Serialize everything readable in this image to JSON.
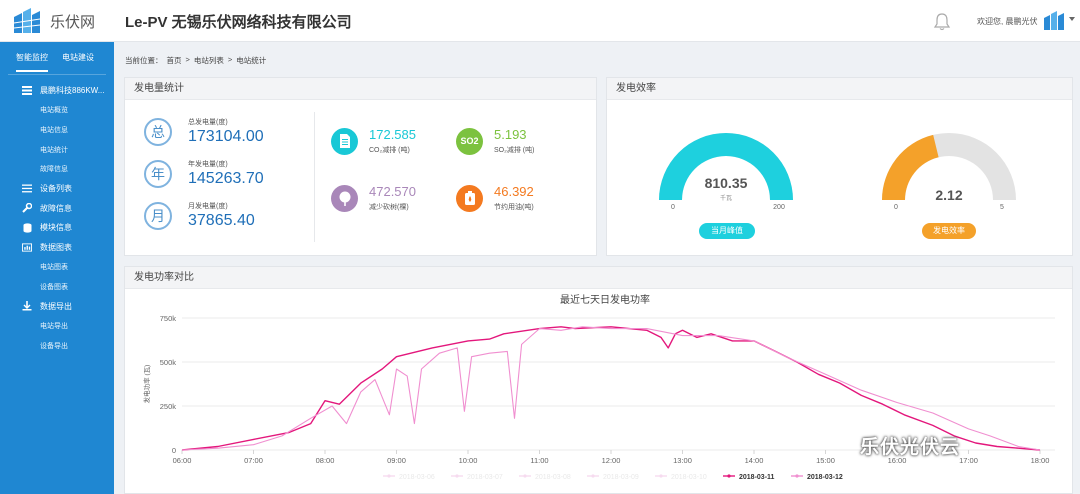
{
  "header": {
    "app_name": "乐伏网",
    "company": "Le-PV 无锡乐伏网络科技有限公司",
    "welcome": "欢迎您, 晨鹏光伏"
  },
  "sidebar": {
    "tabs": [
      "智能监控",
      "电站建设"
    ],
    "items": [
      {
        "label": "晨鹏科技886KW...",
        "icon": "list-icon",
        "children": [
          "电站概览",
          "电站信息",
          "电站统计",
          "故障信息"
        ]
      },
      {
        "label": "设备列表",
        "icon": "menu-icon",
        "children": []
      },
      {
        "label": "故障信息",
        "icon": "wrench-icon",
        "children": []
      },
      {
        "label": "模块信息",
        "icon": "database-icon",
        "children": []
      },
      {
        "label": "数据图表",
        "icon": "chart-icon",
        "children": [
          "电站图表",
          "设备图表"
        ]
      },
      {
        "label": "数据导出",
        "icon": "download-icon",
        "children": [
          "电站导出",
          "设备导出"
        ]
      }
    ]
  },
  "breadcrumb": {
    "prefix": "当前位置：",
    "parts": [
      "首页",
      ">",
      "电站列表",
      ">",
      "电站统计"
    ]
  },
  "generation": {
    "title": "发电量统计",
    "stats": [
      {
        "icon_char": "总",
        "label": "总发电量(度)",
        "value": "173104.00"
      },
      {
        "icon_char": "年",
        "label": "年发电量(度)",
        "value": "145263.70"
      },
      {
        "icon_char": "月",
        "label": "月发电量(度)",
        "value": "37865.40"
      }
    ],
    "env": [
      {
        "value": "172.585",
        "label": "CO₂减排 (吨)",
        "color": "#19c8d6",
        "icon": "document-icon"
      },
      {
        "value": "5.193",
        "label": "SO₂减排 (吨)",
        "color": "#7cc23f",
        "icon": "so2-icon",
        "icon_text": "SO2"
      },
      {
        "value": "472.570",
        "label": "减少砍树(棵)",
        "color": "#a987b9",
        "icon": "tree-icon"
      },
      {
        "value": "46.392",
        "label": "节约用油(吨)",
        "color": "#f47a20",
        "icon": "oil-icon"
      }
    ]
  },
  "efficiency": {
    "title": "发电效率",
    "gauges": [
      {
        "value": 810.35,
        "display": "810.35",
        "unit": "千瓦",
        "min_label": "0",
        "max_label": "200",
        "fraction": 1.0,
        "color": "#1ed0de",
        "pill": "当月峰值"
      },
      {
        "value": 2.12,
        "display": "2.12",
        "unit": "",
        "min_label": "0",
        "max_label": "5",
        "fraction": 0.424,
        "color": "#f4a12a",
        "pill": "发电效率"
      }
    ]
  },
  "compare": {
    "title": "发电功率对比"
  },
  "chart_data": {
    "type": "line",
    "title": "最近七天日发电功率",
    "ylabel": "发电功率 (瓦)",
    "xlabel": "",
    "x_ticks": [
      "06:00",
      "07:00",
      "08:00",
      "09:00",
      "10:00",
      "11:00",
      "12:00",
      "13:00",
      "14:00",
      "15:00",
      "16:00",
      "17:00",
      "18:00"
    ],
    "y_ticks": [
      "0",
      "250k",
      "500k",
      "750k"
    ],
    "xlim": [
      6,
      18
    ],
    "ylim": [
      0,
      750000
    ],
    "grid": true,
    "legend_position": "bottom",
    "series": [
      {
        "name": "2018-03-06",
        "color": "#f6dbef",
        "visible": false,
        "points": [
          [
            6,
            0
          ],
          [
            8,
            120000
          ],
          [
            10,
            550000
          ],
          [
            12,
            690000
          ],
          [
            14,
            560000
          ],
          [
            16,
            300000
          ],
          [
            17.5,
            20000
          ]
        ]
      },
      {
        "name": "2018-03-07",
        "color": "#f6dbef",
        "visible": false,
        "points": [
          [
            6,
            0
          ],
          [
            8,
            120000
          ],
          [
            10,
            550000
          ],
          [
            12,
            690000
          ],
          [
            14,
            560000
          ],
          [
            16,
            300000
          ],
          [
            17.5,
            20000
          ]
        ]
      },
      {
        "name": "2018-03-08",
        "color": "#f6dbef",
        "visible": false,
        "points": [
          [
            6,
            0
          ],
          [
            8,
            120000
          ],
          [
            10,
            550000
          ],
          [
            12,
            690000
          ],
          [
            14,
            560000
          ],
          [
            16,
            300000
          ],
          [
            17.5,
            20000
          ]
        ]
      },
      {
        "name": "2018-03-09",
        "color": "#f6dbef",
        "visible": false,
        "points": [
          [
            6,
            0
          ],
          [
            8,
            120000
          ],
          [
            10,
            550000
          ],
          [
            12,
            690000
          ],
          [
            14,
            560000
          ],
          [
            16,
            300000
          ],
          [
            17.5,
            20000
          ]
        ]
      },
      {
        "name": "2018-03-10",
        "color": "#f6dbef",
        "visible": false,
        "points": [
          [
            6,
            0
          ],
          [
            8,
            120000
          ],
          [
            10,
            550000
          ],
          [
            12,
            690000
          ],
          [
            14,
            560000
          ],
          [
            16,
            300000
          ],
          [
            17.5,
            20000
          ]
        ]
      },
      {
        "name": "2018-03-11",
        "color": "#e3177c",
        "visible": true,
        "points": [
          [
            6,
            0
          ],
          [
            6.5,
            20000
          ],
          [
            7,
            60000
          ],
          [
            7.5,
            100000
          ],
          [
            7.8,
            150000
          ],
          [
            8,
            280000
          ],
          [
            8.2,
            260000
          ],
          [
            8.5,
            380000
          ],
          [
            8.8,
            460000
          ],
          [
            9,
            530000
          ],
          [
            9.5,
            580000
          ],
          [
            10,
            620000
          ],
          [
            10.3,
            630000
          ],
          [
            10.5,
            660000
          ],
          [
            11,
            690000
          ],
          [
            11.3,
            700000
          ],
          [
            11.5,
            690000
          ],
          [
            12,
            700000
          ],
          [
            12.5,
            680000
          ],
          [
            12.7,
            640000
          ],
          [
            12.8,
            580000
          ],
          [
            12.9,
            660000
          ],
          [
            13,
            680000
          ],
          [
            13.2,
            640000
          ],
          [
            13.4,
            660000
          ],
          [
            13.7,
            620000
          ],
          [
            14,
            620000
          ],
          [
            14.3,
            560000
          ],
          [
            14.6,
            500000
          ],
          [
            14.9,
            430000
          ],
          [
            15.2,
            380000
          ],
          [
            15.5,
            310000
          ],
          [
            15.8,
            260000
          ],
          [
            16.1,
            200000
          ],
          [
            16.5,
            140000
          ],
          [
            16.8,
            80000
          ],
          [
            17.1,
            40000
          ],
          [
            17.4,
            20000
          ],
          [
            17.7,
            10000
          ],
          [
            18,
            0
          ]
        ]
      },
      {
        "name": "2018-03-12",
        "color": "#f08fd0",
        "visible": true,
        "points": [
          [
            6,
            0
          ],
          [
            6.5,
            10000
          ],
          [
            7,
            30000
          ],
          [
            7.4,
            80000
          ],
          [
            7.8,
            180000
          ],
          [
            8.1,
            250000
          ],
          [
            8.3,
            150000
          ],
          [
            8.5,
            330000
          ],
          [
            8.7,
            400000
          ],
          [
            8.9,
            200000
          ],
          [
            9,
            460000
          ],
          [
            9.15,
            420000
          ],
          [
            9.25,
            150000
          ],
          [
            9.35,
            460000
          ],
          [
            9.6,
            550000
          ],
          [
            9.85,
            580000
          ],
          [
            9.95,
            220000
          ],
          [
            10.05,
            530000
          ],
          [
            10.3,
            550000
          ],
          [
            10.55,
            560000
          ],
          [
            10.65,
            180000
          ],
          [
            10.75,
            600000
          ],
          [
            11,
            690000
          ],
          [
            11.3,
            680000
          ],
          [
            11.6,
            700000
          ],
          [
            12,
            690000
          ],
          [
            12.5,
            690000
          ],
          [
            13,
            650000
          ],
          [
            13.5,
            650000
          ],
          [
            14,
            620000
          ],
          [
            14.5,
            520000
          ],
          [
            15,
            430000
          ],
          [
            15.5,
            340000
          ],
          [
            16,
            270000
          ],
          [
            16.5,
            210000
          ],
          [
            17,
            120000
          ],
          [
            17.3,
            80000
          ],
          [
            17.7,
            20000
          ],
          [
            18,
            0
          ]
        ]
      }
    ]
  },
  "watermark": "乐伏光伏云"
}
